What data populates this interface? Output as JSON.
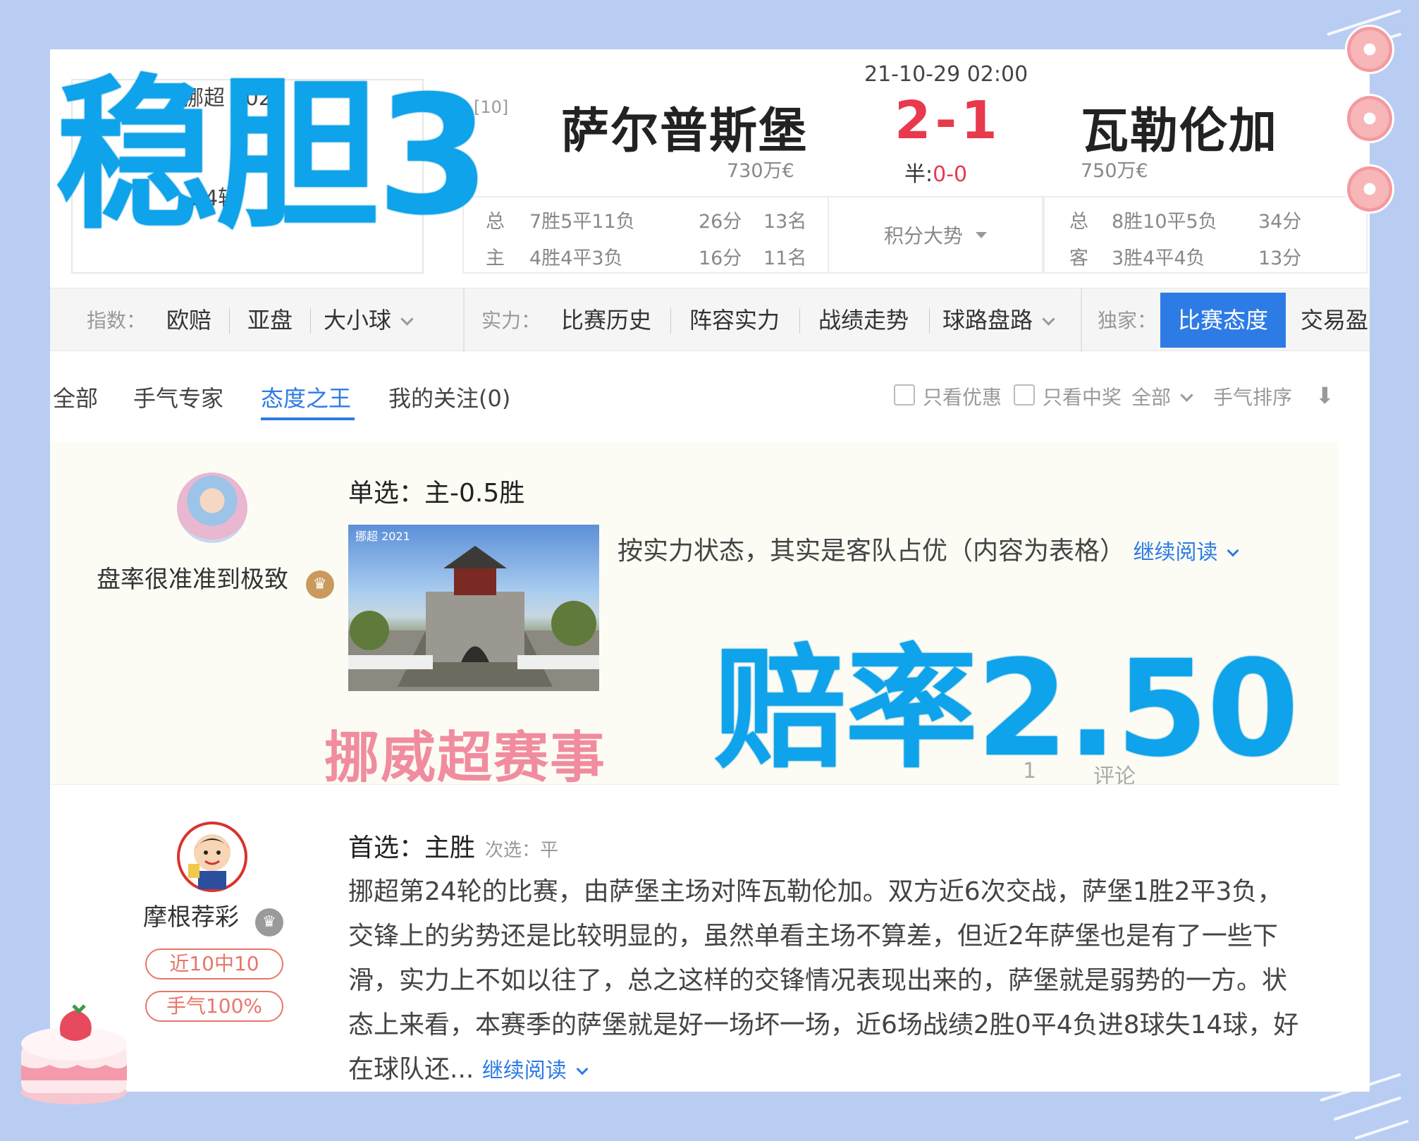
{
  "match": {
    "league": "挪超 2021",
    "round": "24轮",
    "home": {
      "rank": "[10]",
      "name": "萨尔普斯堡",
      "value": "730万€"
    },
    "away": {
      "name": "瓦勒伦加",
      "value": "750万€"
    },
    "datetime": "21-10-29 02:00",
    "score": "2-1",
    "half_label": "半:",
    "half_score": "0-0",
    "home_stats": [
      {
        "label": "总",
        "record": "7胜5平11负",
        "points": "26分",
        "rank": "13名"
      },
      {
        "label": "主",
        "record": "4胜4平3负",
        "points": "16分",
        "rank": "11名"
      }
    ],
    "trend_label": "积分大势",
    "away_stats": [
      {
        "label": "总",
        "record": "8胜10平5负",
        "points": "34分"
      },
      {
        "label": "客",
        "record": "3胜4平4负",
        "points": "13分"
      }
    ]
  },
  "nav": {
    "index_label": "指数：",
    "index_items": [
      "欧赔",
      "亚盘",
      "大小球"
    ],
    "strength_label": "实力：",
    "strength_items": [
      "比赛历史",
      "阵容实力",
      "战绩走势",
      "球路盘路"
    ],
    "exclusive_label": "独家：",
    "exclusive_active": "比赛态度",
    "exclusive_next": "交易盈"
  },
  "tabs": [
    "全部",
    "手气专家",
    "态度之王",
    "我的关注(0)"
  ],
  "active_tab": "态度之王",
  "filters": {
    "only_discount": "只看优惠",
    "only_winning": "只看中奖",
    "scope": "全部",
    "sort": "手气排序"
  },
  "posts": [
    {
      "author": "盘率很准准到极致",
      "pick": "单选：主-0.5胜",
      "thumb_caption": "挪超 2021",
      "summary": "按实力状态，其实是客队占优（内容为表格）",
      "read_more": "继续阅读",
      "likes": "1",
      "comment_label": "评论"
    },
    {
      "author": "摩根荐彩",
      "badges": [
        "近10中10",
        "手气100%"
      ],
      "pick": "首选：主胜",
      "secondary_pick": "次选：平",
      "body": "挪超第24轮的比赛，由萨堡主场对阵瓦勒伦加。双方近6次交战，萨堡1胜2平3负，交锋上的劣势还是比较明显的，虽然单看主场不算差，但近2年萨堡也是有了一些下滑，实力上不如以往了，总之这样的交锋情况表现出来的，萨堡就是弱势的一方。状态上来看，本赛季的萨堡就是好一场坏一场，近6场战绩2胜0平4负进8球失14球，好在球队还...",
      "read_more": "继续阅读"
    }
  ],
  "overlays": {
    "title": "稳胆3",
    "odds": "赔率2.50",
    "league": "挪威超赛事"
  },
  "colors": {
    "accent_blue": "#2d7be5",
    "score_red": "#e8394d",
    "overlay_blue": "#0ea3ea",
    "overlay_pink": "#f08c9e",
    "background": "#b9cdf3"
  }
}
